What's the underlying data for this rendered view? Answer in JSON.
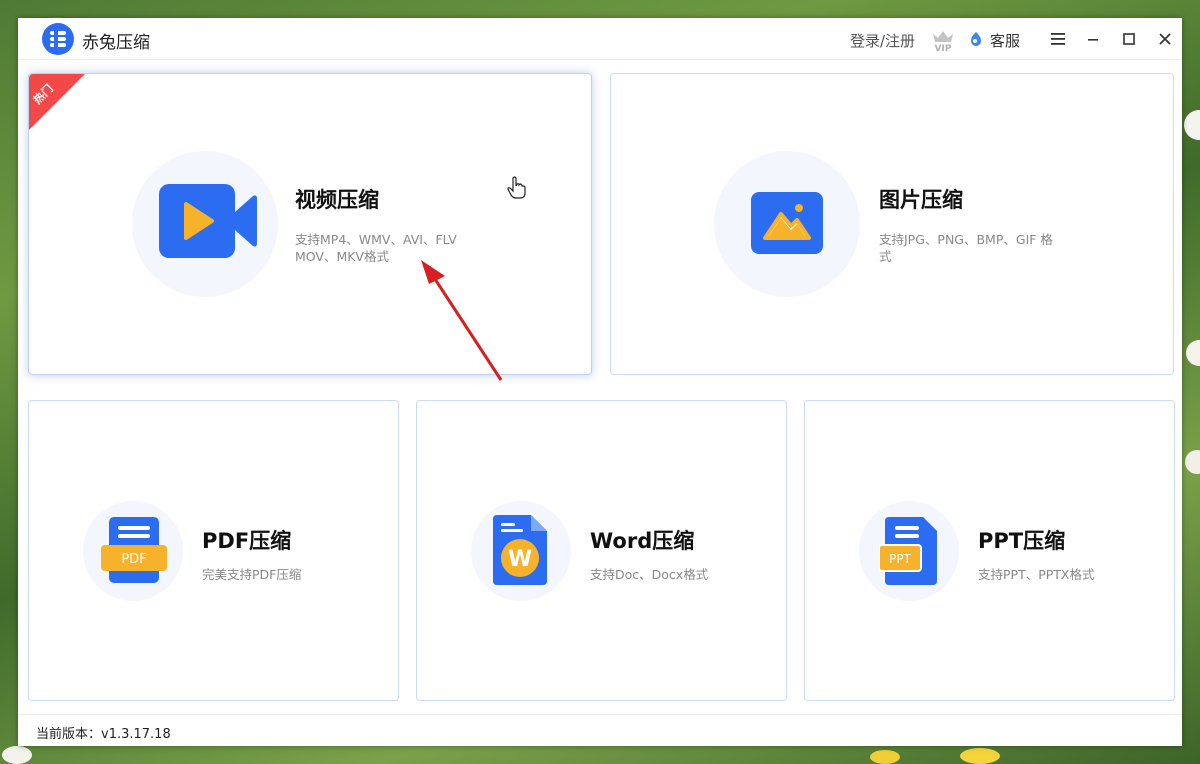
{
  "app": {
    "title": "赤兔压缩"
  },
  "header": {
    "login_label": "登录/注册",
    "vip_label": "VIP",
    "service_label": "客服"
  },
  "cards": {
    "video": {
      "badge": "热门",
      "title": "视频压缩",
      "desc_line1": "支持MP4、WMV、AVI、FLV",
      "desc_line2": "MOV、MKV格式"
    },
    "image": {
      "title": "图片压缩",
      "desc_line1": "支持JPG、PNG、BMP、GIF 格",
      "desc_line2": "式"
    },
    "pdf": {
      "title": "PDF压缩",
      "desc": "完美支持PDF压缩",
      "icon_text": "PDF"
    },
    "word": {
      "title": "Word压缩",
      "desc": "支持Doc、Docx格式",
      "icon_text": "W"
    },
    "ppt": {
      "title": "PPT压缩",
      "desc": "支持PPT、PPTX格式",
      "icon_text": "PPT"
    }
  },
  "status": {
    "version": "当前版本：v1.3.17.18"
  },
  "colors": {
    "brand": "#2c6cf0",
    "accent": "#f5b22a",
    "hot": "#f24848",
    "card_border": "#c9dcf3"
  }
}
